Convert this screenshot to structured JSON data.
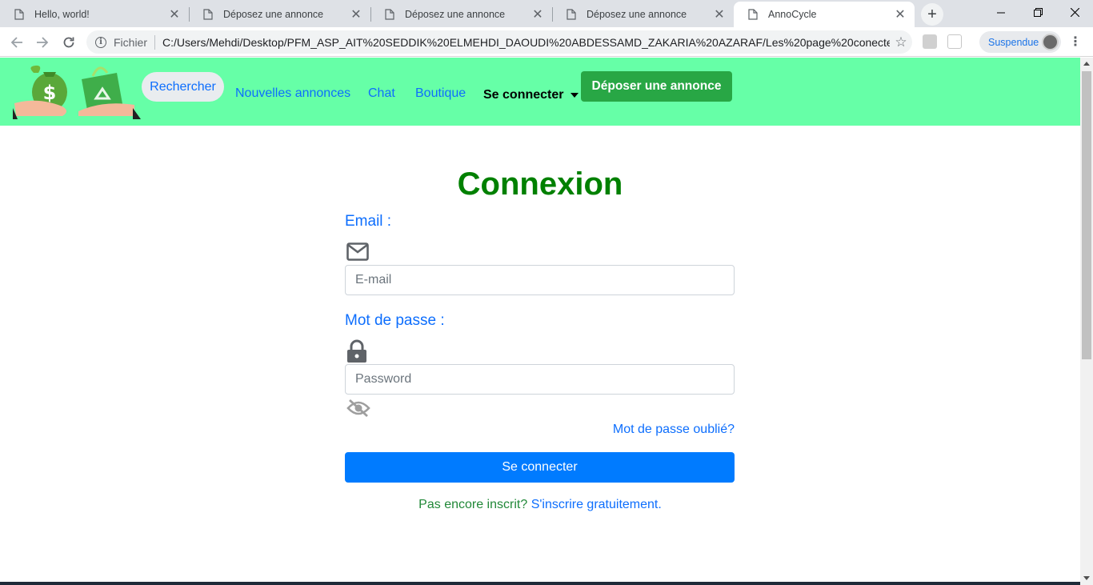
{
  "tabs": [
    {
      "title": "Hello, world!"
    },
    {
      "title": "Déposez une annonce"
    },
    {
      "title": "Déposez une annonce"
    },
    {
      "title": "Déposez une annonce"
    },
    {
      "title": "AnnoCycle"
    }
  ],
  "omnibox": {
    "scheme_label": "Fichier",
    "url": "C:/Users/Mehdi/Desktop/PFM_ASP_AIT%20SEDDIK%20ELMEHDI_DAOUDI%20ABDESSAMD_ZAKARIA%20AZARAF/Les%20page%20conecter%2..."
  },
  "profile": {
    "label": "Suspendue"
  },
  "navbar": {
    "links": [
      "Rechercher",
      "Nouvelles annonces",
      "Chat",
      "Boutique"
    ],
    "login_dropdown": "Se connecter",
    "cta": "Déposer une annonce",
    "bg_color": "#66ffa7"
  },
  "login": {
    "title": "Connexion",
    "email_label": "Email :",
    "email_placeholder": "E-mail",
    "password_label": "Mot de passe :",
    "password_placeholder": "Password",
    "forgot": "Mot de passe oublié?",
    "submit": "Se connecter",
    "signup_question": "Pas encore inscrit?",
    "signup_link": "S'inscrire gratuitement.",
    "title_color": "#008000",
    "accent": "#007bff"
  },
  "icons": [
    "file-icon",
    "close-icon",
    "plus-icon",
    "back-icon",
    "forward-icon",
    "reload-icon",
    "info-icon",
    "star-icon",
    "mail-icon",
    "lock-icon",
    "eye-off-icon",
    "caret-down-icon"
  ]
}
